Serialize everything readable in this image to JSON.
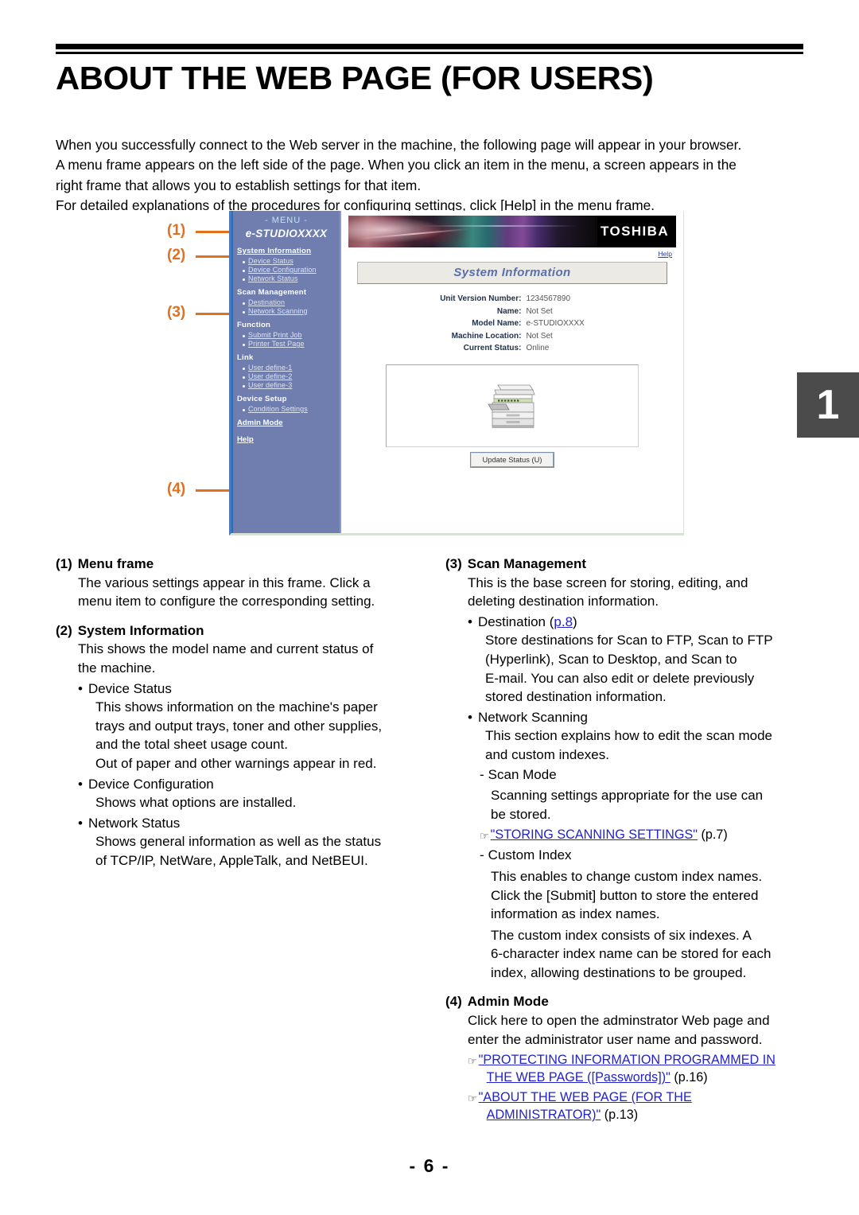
{
  "document": {
    "title": "ABOUT THE WEB PAGE (FOR USERS)",
    "page_number": "- 6 -",
    "chapter_tab": "1"
  },
  "intro": {
    "line1": "When you successfully connect to the Web server in the machine, the following page will appear in your browser.",
    "line2": "A menu frame appears on the left side of the page. When you click an item in the menu, a screen appears in the",
    "line3": "right frame that allows you to establish settings for that item.",
    "line4": "For detailed explanations of the procedures for configuring settings, click [Help] in the menu frame."
  },
  "callouts": {
    "c1": "(1)",
    "c2": "(2)",
    "c3": "(3)",
    "c4": "(4)"
  },
  "screenshot": {
    "menu": {
      "title": "- MENU -",
      "model": "e-STUDIOXXXX",
      "groups": [
        {
          "head": "System Information",
          "head_is_link": true,
          "items": [
            "Device Status",
            "Device Configuration",
            "Network Status"
          ]
        },
        {
          "head": "Scan Management",
          "head_is_link": false,
          "items": [
            "Destination",
            "Network Scanning"
          ]
        },
        {
          "head": "Function",
          "head_is_link": false,
          "items": [
            "Submit Print Job",
            "Printer Test Page"
          ]
        },
        {
          "head": "Link",
          "head_is_link": false,
          "items": [
            "User define-1",
            "User define-2",
            "User define-3"
          ]
        },
        {
          "head": "Device Setup",
          "head_is_link": false,
          "items": [
            "Condition Settings"
          ]
        }
      ],
      "admin_mode": "Admin Mode",
      "help": "Help"
    },
    "right": {
      "brand": "TOSHIBA",
      "help_link": "Help",
      "panel_title": "System Information",
      "info": [
        {
          "key": "Unit Version Number:",
          "value": "1234567890"
        },
        {
          "key": "Name:",
          "value": "Not Set"
        },
        {
          "key": "Model Name:",
          "value": "e-STUDIOXXXX"
        },
        {
          "key": "Machine Location:",
          "value": "Not Set"
        },
        {
          "key": "Current Status:",
          "value": "Online"
        }
      ],
      "update_button": "Update Status (U)"
    }
  },
  "sections": {
    "s1": {
      "number": "(1)",
      "title": "Menu frame",
      "para_l1": "The various settings appear in this frame. Click a",
      "para_l2": "menu item to configure the corresponding setting."
    },
    "s2": {
      "number": "(2)",
      "title": "System Information",
      "para_l1": "This shows the model name and current status of",
      "para_l2": "the machine.",
      "b1_label": "Device Status",
      "b1_l1": "This shows information on the machine's paper",
      "b1_l2": "trays and output trays, toner and other supplies,",
      "b1_l3": "and the total sheet usage count.",
      "b1_l4": "Out of paper and other warnings appear in red.",
      "b2_label": "Device Configuration",
      "b2_l1": "Shows what options are installed.",
      "b3_label": "Network Status",
      "b3_l1": "Shows general information as well as the status",
      "b3_l2": "of TCP/IP, NetWare, AppleTalk, and NetBEUI."
    },
    "s3": {
      "number": "(3)",
      "title": "Scan Management",
      "para_l1": "This is the base screen for storing, editing, and",
      "para_l2": "deleting destination information.",
      "b1_label_pre": "Destination (",
      "b1_label_link": "p.8",
      "b1_label_post": ")",
      "b1_l1": "Store destinations for Scan to FTP, Scan to FTP",
      "b1_l2": "(Hyperlink), Scan to Desktop, and Scan to",
      "b1_l3": "E-mail. You can also edit or delete previously",
      "b1_l4": "stored destination information.",
      "b2_label": "Network Scanning",
      "b2_l1": "This section explains how to edit the scan mode",
      "b2_l2": "and custom indexes.",
      "d1_label": "Scan Mode",
      "d1_l1": "Scanning settings appropriate for the use can",
      "d1_l2": "be stored.",
      "d1_ref_link": "\"STORING SCANNING SETTINGS\"",
      "d1_ref_page": "(p.7)",
      "d2_label": "Custom Index",
      "d2_l1": "This enables to change custom index names.",
      "d2_l2": "Click the [Submit] button to store the entered",
      "d2_l3": "information as index names.",
      "d2_l4": "The custom index consists of six indexes. A",
      "d2_l5": "6-character index name can be stored for each",
      "d2_l6": "index, allowing destinations to be grouped."
    },
    "s4": {
      "number": "(4)",
      "title": "Admin Mode",
      "para_l1": "Click here to open the adminstrator Web page and",
      "para_l2": "enter the administrator user name and password.",
      "ref1_l1": "\"PROTECTING INFORMATION PROGRAMMED IN",
      "ref1_l2": "THE WEB PAGE ([Passwords])\"",
      "ref1_page": "(p.16)",
      "ref2_l1": "\"ABOUT THE WEB PAGE (FOR THE",
      "ref2_l2": "ADMINISTRATOR)\"",
      "ref2_page": "(p.13)"
    }
  },
  "icons": {
    "hand": "☞",
    "bullet": "•",
    "dash": "-"
  },
  "colors": {
    "callout": "#e2701e",
    "link": "#2222cc",
    "menu_bg": "#6f7eae",
    "chapter_tab": "#4b4b4b"
  }
}
